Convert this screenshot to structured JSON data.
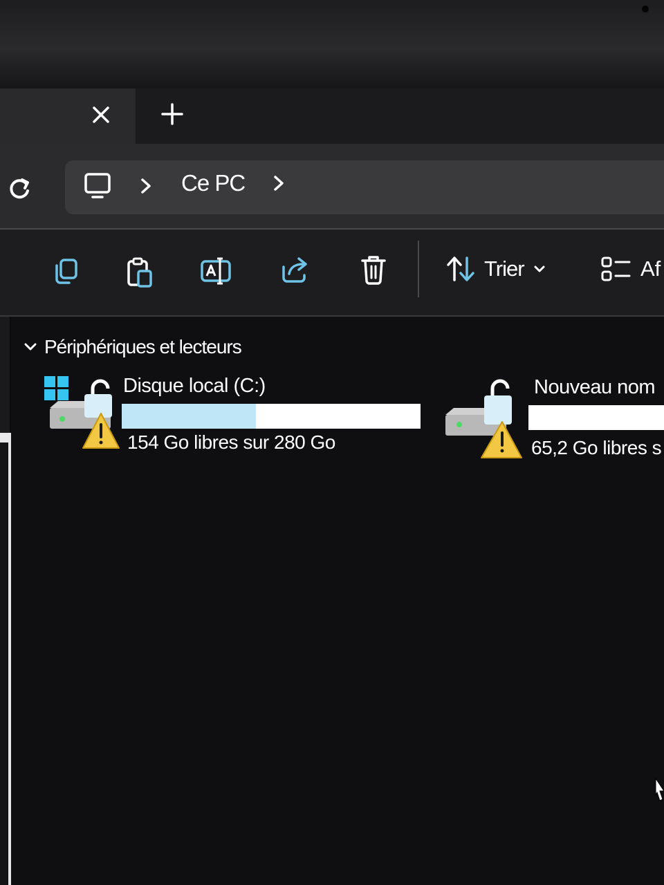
{
  "breadcrumb": {
    "location": "Ce PC"
  },
  "toolbar": {
    "sort_label": "Trier",
    "view_label": "Af"
  },
  "section": {
    "title": "Périphériques et lecteurs"
  },
  "drives": [
    {
      "name": "Disque local (C:)",
      "free_text": "154 Go libres sur 280 Go",
      "used_fraction": 0.45
    },
    {
      "name": "Nouveau nom",
      "free_text": "65,2 Go libres s",
      "used_fraction": 0.0
    }
  ],
  "colors": {
    "accent": "#6fc3e6",
    "bar_fill": "#bfe6f7",
    "warning": "#f2c744"
  }
}
